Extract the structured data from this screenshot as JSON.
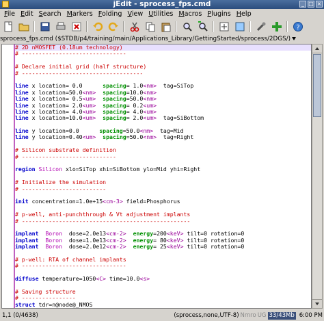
{
  "window": {
    "title": "jEdit - sprocess_fps.cmd"
  },
  "menu": [
    "File",
    "Edit",
    "Search",
    "Markers",
    "Folding",
    "View",
    "Utilities",
    "Macros",
    "Plugins",
    "Help"
  ],
  "toolbar": [
    "new-file-icon",
    "open-folder-icon",
    "save-icon",
    "print-icon",
    "close-x-icon",
    "undo-icon",
    "redo-icon",
    "cut-icon",
    "copy-icon",
    "paste-icon",
    "find-icon",
    "find-next-icon",
    "zoom-icon",
    "fullscreen-icon",
    "settings-icon",
    "plugin-add-icon",
    "help-icon"
  ],
  "buffer": {
    "path": "sprocess_fps.cmd ($STDB/p4/training/main/Applications_Library/GettingStarted/sprocess/2DGS/)"
  },
  "code_lines": [
    [
      [
        "cmt",
        "# 2D nMOSFET (0.18um technology)"
      ]
    ],
    [
      [
        "cmt",
        "# -------------------------------"
      ]
    ],
    [],
    [
      [
        "cmt",
        "# Declare initial grid (half structure)"
      ]
    ],
    [
      [
        "cmt",
        "# ------------------------------------"
      ]
    ],
    [],
    [
      [
        "kw",
        "line"
      ],
      [
        "txt",
        " x location= 0.0      "
      ],
      [
        "kw2",
        "spacing"
      ],
      [
        "txt",
        "= 1.0"
      ],
      [
        "un",
        "<nm>"
      ],
      [
        "txt",
        "  tag=SiTop"
      ]
    ],
    [
      [
        "kw",
        "line"
      ],
      [
        "txt",
        " x location=50.0"
      ],
      [
        "un",
        "<nm>"
      ],
      [
        "txt",
        "  "
      ],
      [
        "kw2",
        "spacing"
      ],
      [
        "txt",
        "=10.0"
      ],
      [
        "un",
        "<nm>"
      ]
    ],
    [
      [
        "kw",
        "line"
      ],
      [
        "txt",
        " x location= 0.5"
      ],
      [
        "un",
        "<um>"
      ],
      [
        "txt",
        "  "
      ],
      [
        "kw2",
        "spacing"
      ],
      [
        "txt",
        "=50.0"
      ],
      [
        "un",
        "<nm>"
      ]
    ],
    [
      [
        "kw",
        "line"
      ],
      [
        "txt",
        " x location= 2.0"
      ],
      [
        "un",
        "<um>"
      ],
      [
        "txt",
        "  "
      ],
      [
        "kw2",
        "spacing"
      ],
      [
        "txt",
        "= 0.2"
      ],
      [
        "un",
        "<um>"
      ]
    ],
    [
      [
        "kw",
        "line"
      ],
      [
        "txt",
        " x location= 4.0"
      ],
      [
        "un",
        "<um>"
      ],
      [
        "txt",
        "  "
      ],
      [
        "kw2",
        "spacing"
      ],
      [
        "txt",
        "= 4.0"
      ],
      [
        "un",
        "<um>"
      ]
    ],
    [
      [
        "kw",
        "line"
      ],
      [
        "txt",
        " x location=10.0"
      ],
      [
        "un",
        "<um>"
      ],
      [
        "txt",
        "  "
      ],
      [
        "kw2",
        "spacing"
      ],
      [
        "txt",
        "= 2.0"
      ],
      [
        "un",
        "<um>"
      ],
      [
        "txt",
        "  tag=SiBottom"
      ]
    ],
    [],
    [
      [
        "kw",
        "line"
      ],
      [
        "txt",
        " y location=0.0      "
      ],
      [
        "kw2",
        "spacing"
      ],
      [
        "txt",
        "=50.0"
      ],
      [
        "un",
        "<nm>"
      ],
      [
        "txt",
        "  tag=Mid"
      ]
    ],
    [
      [
        "kw",
        "line"
      ],
      [
        "txt",
        " y location=0.40"
      ],
      [
        "un",
        "<um>"
      ],
      [
        "txt",
        "  "
      ],
      [
        "kw2",
        "spacing"
      ],
      [
        "txt",
        "=50.0"
      ],
      [
        "un",
        "<nm>"
      ],
      [
        "txt",
        "  tag=Right"
      ]
    ],
    [],
    [
      [
        "cmt",
        "# Silicon substrate definition"
      ]
    ],
    [
      [
        "cmt",
        "# ----------------------------"
      ]
    ],
    [],
    [
      [
        "kw",
        "region"
      ],
      [
        "txt",
        " "
      ],
      [
        "lit",
        "Silicon"
      ],
      [
        "txt",
        " xlo=SiTop xhi=SiBottom ylo=Mid yhi=Right"
      ]
    ],
    [],
    [
      [
        "cmt",
        "# Initialize the simulation"
      ]
    ],
    [
      [
        "cmt",
        "# -------------------------"
      ]
    ],
    [],
    [
      [
        "kw",
        "init"
      ],
      [
        "txt",
        " concentration=1.0e+15"
      ],
      [
        "un",
        "<cm-3>"
      ],
      [
        "txt",
        " field=Phosphorus"
      ]
    ],
    [],
    [
      [
        "cmt",
        "# p-well, anti-punchthrough & Vt adjustment implants"
      ]
    ],
    [
      [
        "cmt",
        "# --------------------------------------------------"
      ]
    ],
    [],
    [
      [
        "kw",
        "implant"
      ],
      [
        "txt",
        "  "
      ],
      [
        "lit",
        "Boron"
      ],
      [
        "txt",
        "  dose=2.0e13"
      ],
      [
        "un",
        "<cm-2>"
      ],
      [
        "txt",
        "  "
      ],
      [
        "kw2",
        "energy"
      ],
      [
        "txt",
        "=200"
      ],
      [
        "un",
        "<keV>"
      ],
      [
        "txt",
        " tilt=0 rotation=0"
      ]
    ],
    [
      [
        "kw",
        "implant"
      ],
      [
        "txt",
        "  "
      ],
      [
        "lit",
        "Boron"
      ],
      [
        "txt",
        "  dose=1.0e13"
      ],
      [
        "un",
        "<cm-2>"
      ],
      [
        "txt",
        "  "
      ],
      [
        "kw2",
        "energy"
      ],
      [
        "txt",
        "= 80"
      ],
      [
        "un",
        "<keV>"
      ],
      [
        "txt",
        " tilt=0 rotation=0"
      ]
    ],
    [
      [
        "kw",
        "implant"
      ],
      [
        "txt",
        "  "
      ],
      [
        "lit",
        "Boron"
      ],
      [
        "txt",
        "  dose=2.0e12"
      ],
      [
        "un",
        "<cm-2>"
      ],
      [
        "txt",
        "  "
      ],
      [
        "kw2",
        "energy"
      ],
      [
        "txt",
        "= 25"
      ],
      [
        "un",
        "<keV>"
      ],
      [
        "txt",
        " tilt=0 rotation=0"
      ]
    ],
    [],
    [
      [
        "cmt",
        "# p-well: RTA of channel implants"
      ]
    ],
    [
      [
        "cmt",
        "# -------------------------------"
      ]
    ],
    [],
    [
      [
        "kw",
        "diffuse"
      ],
      [
        "txt",
        " temperature=1050"
      ],
      [
        "un",
        "<C>"
      ],
      [
        "txt",
        " time=10.0"
      ],
      [
        "un",
        "<s>"
      ]
    ],
    [],
    [
      [
        "cmt",
        "# Saving structure"
      ]
    ],
    [
      [
        "cmt",
        "# ----------------"
      ]
    ],
    [
      [
        "kw",
        "struct"
      ],
      [
        "txt",
        " tdr=n@node@_NMOS"
      ]
    ]
  ],
  "status": {
    "position": "1,1 (0/4638)",
    "buffer_info": "(sprocess,none,UTF-8)",
    "mode_flags": "Nmro",
    "encoding": "UG",
    "memory": "33/43Mb",
    "clock": "6:00 PM"
  },
  "colors": {
    "comment": "#cc0000",
    "keyword": "#0000cc",
    "keyword2": "#009000",
    "unit": "#990099",
    "fold_bar": "#c060c0",
    "titlebar": "#2b4d7e"
  }
}
